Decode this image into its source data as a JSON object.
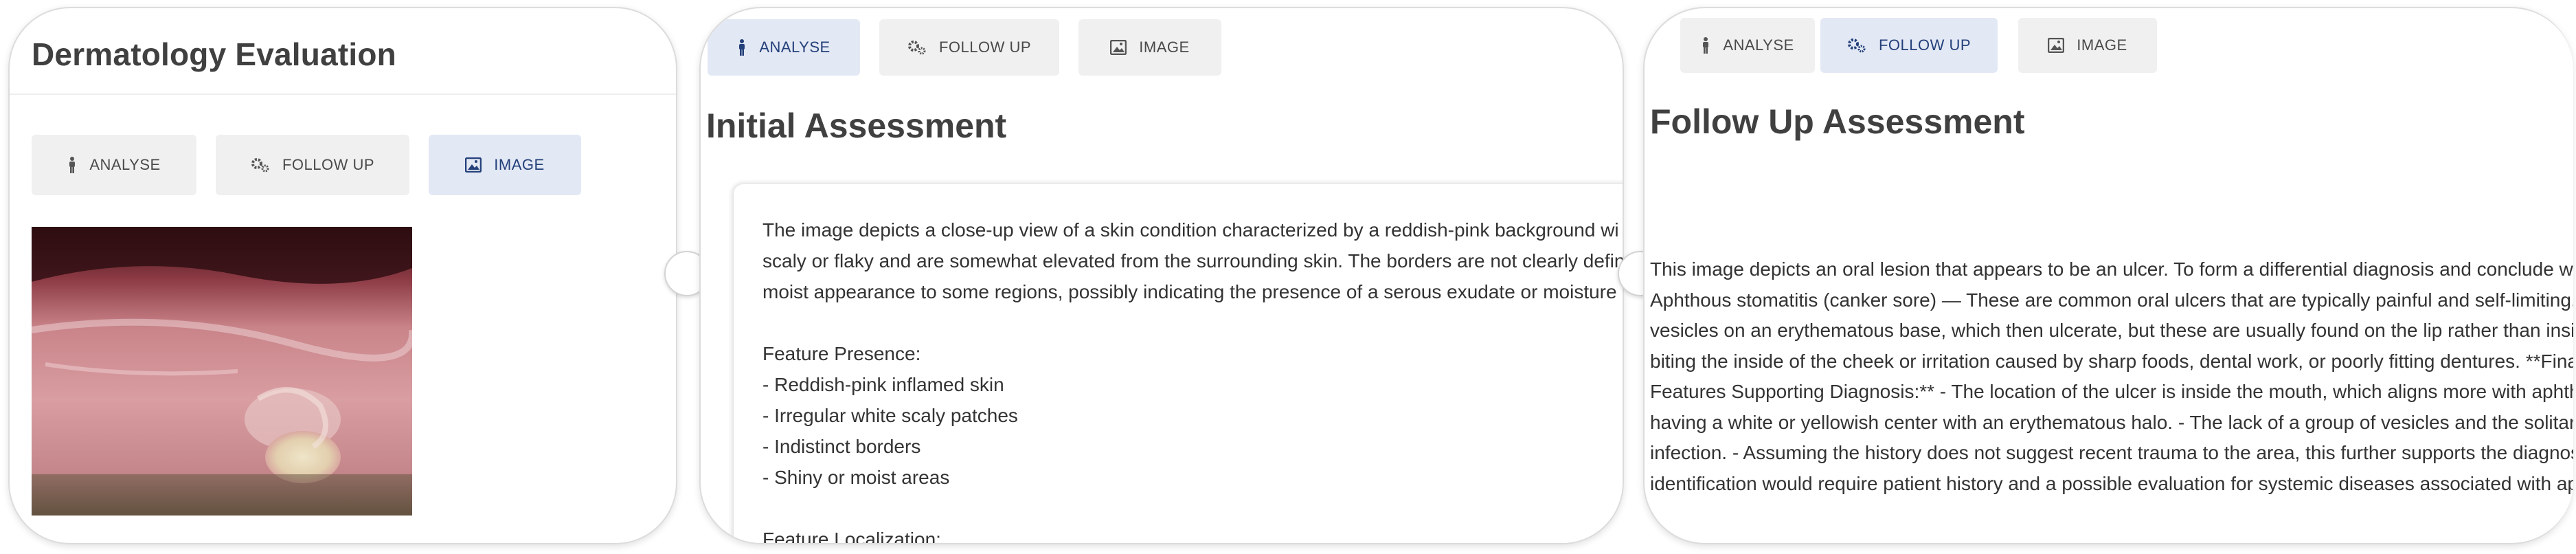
{
  "panel1": {
    "title": "Dermatology Evaluation",
    "tabs": [
      {
        "label": "ANALYSE",
        "icon": "person-icon"
      },
      {
        "label": "FOLLOW UP",
        "icon": "gears-icon"
      },
      {
        "label": "IMAGE",
        "icon": "image-icon",
        "active": true
      }
    ],
    "image_subject": "oral lesion photograph"
  },
  "panel2": {
    "tabs": [
      {
        "label": "ANALYSE",
        "icon": "person-icon",
        "active": true
      },
      {
        "label": "FOLLOW UP",
        "icon": "gears-icon"
      },
      {
        "label": "IMAGE",
        "icon": "image-icon"
      }
    ],
    "title": "Initial Assessment",
    "lines": [
      "The image depicts a close-up view of a skin condition characterized by a reddish-pink background wi",
      "scaly or flaky and are somewhat elevated from the surrounding skin. The borders are not clearly defin",
      "moist appearance to some regions, possibly indicating the presence of a serous exudate or moisture",
      "",
      "Feature Presence:",
      "- Reddish-pink inflamed skin",
      "- Irregular white scaly patches",
      "- Indistinct borders",
      "- Shiny or moist areas",
      "",
      "Feature Localization:"
    ]
  },
  "panel3": {
    "tabs": [
      {
        "label": "ANALYSE",
        "icon": "person-icon"
      },
      {
        "label": "FOLLOW UP",
        "icon": "gears-icon",
        "active": true
      },
      {
        "label": "IMAGE",
        "icon": "image-icon"
      }
    ],
    "title": "Follow Up Assessment",
    "lines": [
      "This image depicts an oral lesion that appears to be an ulcer. To form a differential diagnosis and conclude wi",
      "Aphthous stomatitis (canker sore) — These are common oral ulcers that are typically painful and self-limiting.",
      "vesicles on an erythematous base, which then ulcerate, but these are usually found on the lip rather than inside",
      "biting the inside of the cheek or irritation caused by sharp foods, dental work, or poorly fitting dentures. **Fina",
      "Features Supporting Diagnosis:** - The location of the ulcer is inside the mouth, which aligns more with aphth",
      "having a white or yellowish center with an erythematous halo. - The lack of a group of vesicles and the solitary",
      "infection. - Assuming the history does not suggest recent trauma to the area, this further supports the diagnos",
      "identification would require patient history and a possible evaluation for systemic diseases associated with ap"
    ]
  }
}
